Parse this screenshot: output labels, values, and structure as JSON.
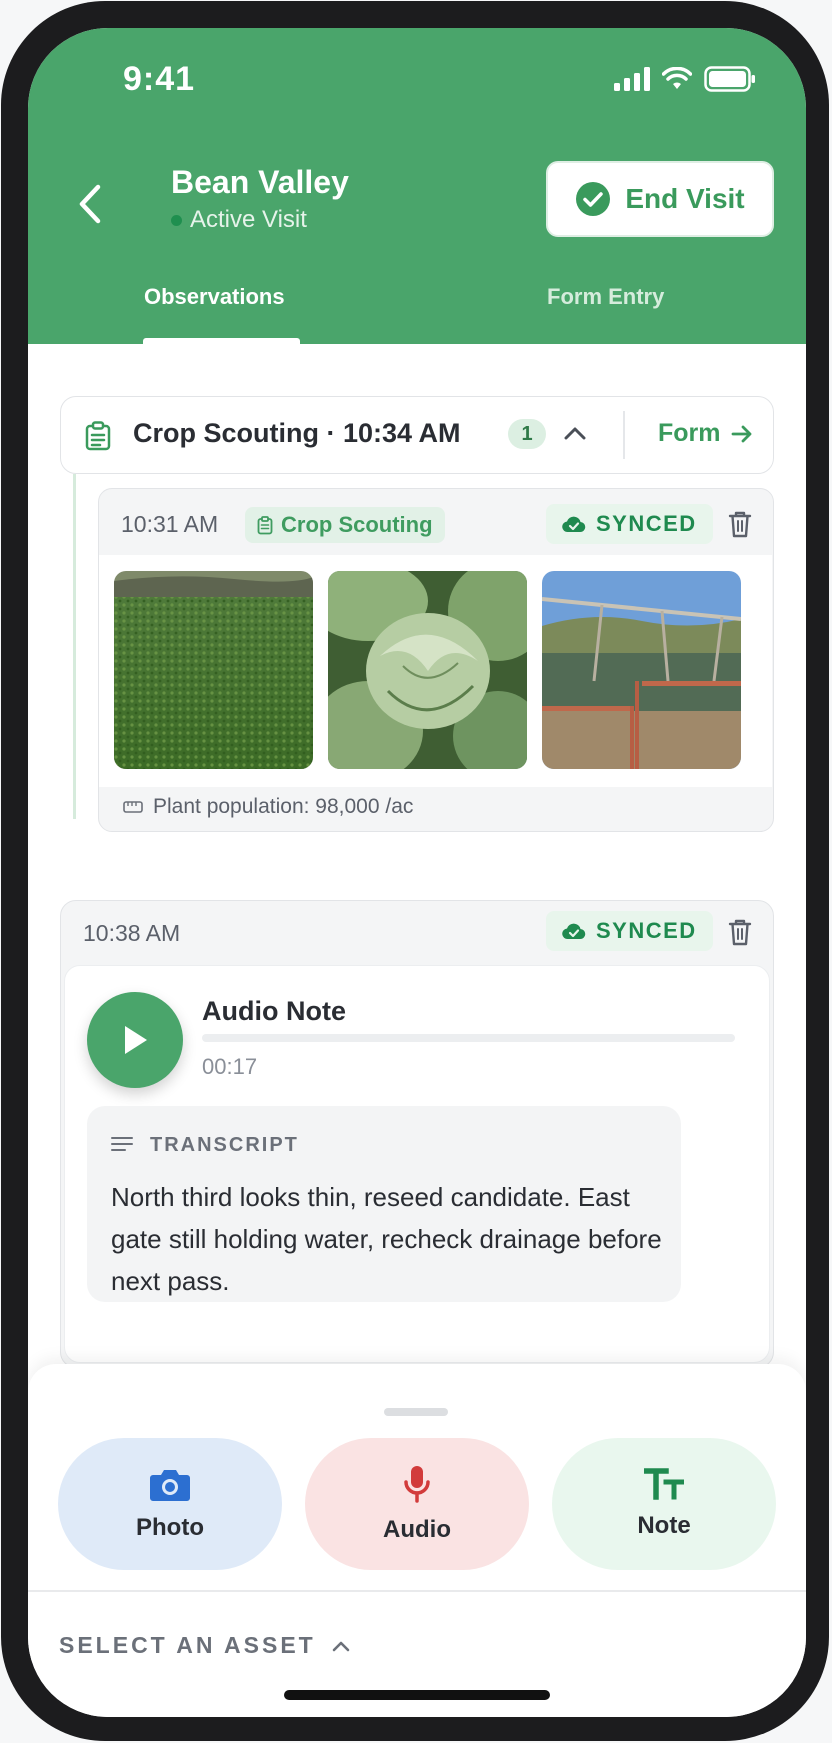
{
  "status_bar": {
    "time": "9:41"
  },
  "header": {
    "title": "Bean Valley",
    "subtitle": "Active Visit",
    "end_visit_label": "End Visit",
    "tabs": [
      {
        "label": "Observations",
        "active": true
      },
      {
        "label": "Form Entry",
        "active": false
      }
    ]
  },
  "form_card": {
    "title": "Crop Scouting · 10:34 AM",
    "count": "1",
    "form_link": "Form"
  },
  "observation_1": {
    "time": "10:31 AM",
    "tag": "Crop Scouting",
    "status": "SYNCED",
    "photos": [
      "field",
      "cabbage",
      "irrigation"
    ],
    "measurement": "Plant population: 98,000 /ac"
  },
  "observation_2": {
    "time": "10:38 AM",
    "status": "SYNCED",
    "audio_title": "Audio Note",
    "duration": "00:17",
    "transcript_label": "TRANSCRIPT",
    "transcript_text": "North third looks thin, reseed candidate. East gate still holding water, recheck drainage before next pass."
  },
  "actions": [
    {
      "label": "Photo",
      "icon": "camera-icon"
    },
    {
      "label": "Audio",
      "icon": "microphone-icon"
    },
    {
      "label": "Note",
      "icon": "text-size-icon"
    }
  ],
  "asset_selector": {
    "label": "SELECT AN ASSET"
  },
  "colors": {
    "brand_green": "#4aa56b",
    "synced_green": "#1f8a4f",
    "photo_blue": "#2c6fd1",
    "audio_red": "#d23b3b"
  }
}
